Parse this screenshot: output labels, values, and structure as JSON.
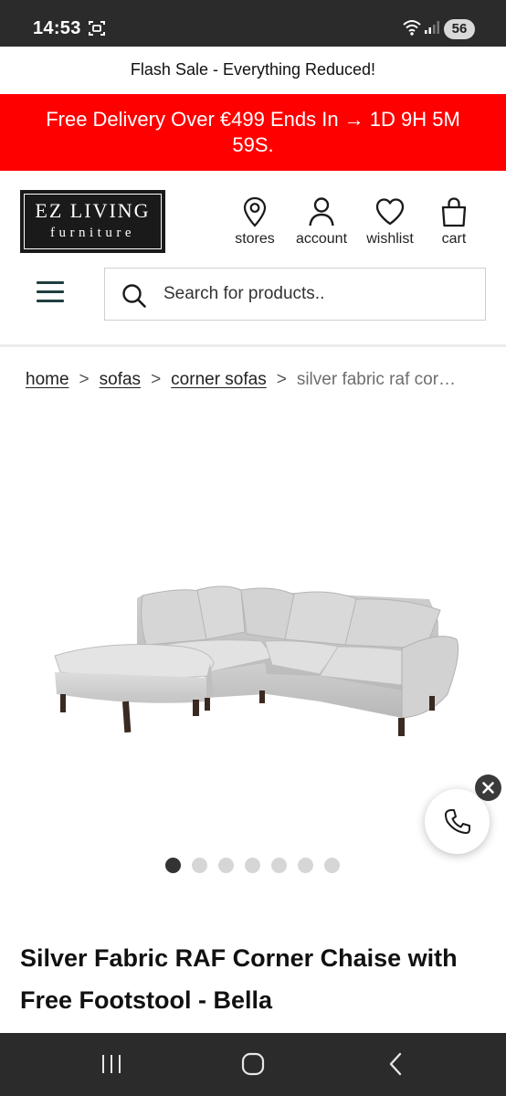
{
  "status_bar": {
    "time": "14:53",
    "battery": "56",
    "icons": [
      "screenshot-icon",
      "wifi-icon",
      "signal-icon"
    ]
  },
  "promo": {
    "text": "Flash Sale - Everything Reduced!"
  },
  "delivery_banner": {
    "text": "Free Delivery Over €499 Ends In → 1D 9H 5M 59S.",
    "background": "#ff0000"
  },
  "logo": {
    "line1": "EZ LIVING",
    "line2": "furniture"
  },
  "nav": {
    "stores": "stores",
    "account": "account",
    "wishlist": "wishlist",
    "cart": "cart"
  },
  "search": {
    "placeholder": "Search for products.."
  },
  "breadcrumb": {
    "items": [
      "home",
      "sofas",
      "corner sofas"
    ],
    "separator": ">",
    "current": "silver fabric raf cor…"
  },
  "gallery": {
    "image_count": 7,
    "active_index": 0
  },
  "product": {
    "title": "Silver Fabric RAF Corner Chaise with Free Footstool - Bella"
  },
  "colors": {
    "banner_red": "#ff0000",
    "dark": "#2b2b2b",
    "menu": "#1f3f3f"
  }
}
